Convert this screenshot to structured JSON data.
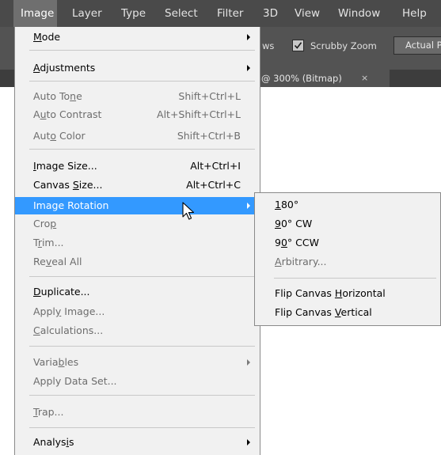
{
  "menubar": {
    "items": [
      "Image",
      "Layer",
      "Type",
      "Select",
      "Filter",
      "3D",
      "View",
      "Window",
      "Help"
    ]
  },
  "options_bar": {
    "partial_label": "ws",
    "scrubby_zoom_label": "Scrubby Zoom",
    "scrubby_zoom_checked": true,
    "actual_button_label": "Actual P"
  },
  "document_tab": {
    "title": "@ 300% (Bitmap)",
    "close": "×"
  },
  "image_menu": {
    "items": [
      {
        "pre": "",
        "u": "M",
        "post": "ode",
        "shortcut": "",
        "submenu": true,
        "enabled": true
      },
      {
        "pre": "",
        "u": "A",
        "post": "djustments",
        "shortcut": "",
        "submenu": true,
        "enabled": true
      },
      {
        "pre": "Auto To",
        "u": "n",
        "post": "e",
        "shortcut": "Shift+Ctrl+L",
        "submenu": false,
        "enabled": false
      },
      {
        "pre": "A",
        "u": "u",
        "post": "to Contrast",
        "shortcut": "Alt+Shift+Ctrl+L",
        "submenu": false,
        "enabled": false
      },
      {
        "pre": "Aut",
        "u": "o",
        "post": " Color",
        "shortcut": "Shift+Ctrl+B",
        "submenu": false,
        "enabled": false
      },
      {
        "pre": "",
        "u": "I",
        "post": "mage Size...",
        "shortcut": "Alt+Ctrl+I",
        "submenu": false,
        "enabled": true
      },
      {
        "pre": "Canvas ",
        "u": "S",
        "post": "ize...",
        "shortcut": "Alt+Ctrl+C",
        "submenu": false,
        "enabled": true
      },
      {
        "pre": "Image Rotation",
        "u": "",
        "post": "",
        "shortcut": "",
        "submenu": true,
        "enabled": true,
        "highlighted": true
      },
      {
        "pre": "Cro",
        "u": "p",
        "post": "",
        "shortcut": "",
        "submenu": false,
        "enabled": false
      },
      {
        "pre": "T",
        "u": "r",
        "post": "im...",
        "shortcut": "",
        "submenu": false,
        "enabled": false
      },
      {
        "pre": "Re",
        "u": "v",
        "post": "eal All",
        "shortcut": "",
        "submenu": false,
        "enabled": false
      },
      {
        "pre": "",
        "u": "D",
        "post": "uplicate...",
        "shortcut": "",
        "submenu": false,
        "enabled": true
      },
      {
        "pre": "Appl",
        "u": "y",
        "post": " Image...",
        "shortcut": "",
        "submenu": false,
        "enabled": false
      },
      {
        "pre": "",
        "u": "C",
        "post": "alculations...",
        "shortcut": "",
        "submenu": false,
        "enabled": false
      },
      {
        "pre": "Varia",
        "u": "b",
        "post": "les",
        "shortcut": "",
        "submenu": true,
        "enabled": false
      },
      {
        "pre": "Apply Data Set...",
        "u": "",
        "post": "",
        "shortcut": "",
        "submenu": false,
        "enabled": false
      },
      {
        "pre": "",
        "u": "T",
        "post": "rap...",
        "shortcut": "",
        "submenu": false,
        "enabled": false
      },
      {
        "pre": "Analys",
        "u": "i",
        "post": "s",
        "shortcut": "",
        "submenu": true,
        "enabled": true
      }
    ]
  },
  "rotation_submenu": {
    "items": [
      {
        "pre": "",
        "u": "1",
        "post": "80°",
        "enabled": true
      },
      {
        "pre": "",
        "u": "9",
        "post": "0° CW",
        "enabled": true
      },
      {
        "pre": "9",
        "u": "0",
        "post": "° CCW",
        "enabled": true
      },
      {
        "pre": "",
        "u": "A",
        "post": "rbitrary...",
        "enabled": false
      },
      {
        "pre": "Flip Canvas ",
        "u": "H",
        "post": "orizontal",
        "enabled": true
      },
      {
        "pre": "Flip Canvas ",
        "u": "V",
        "post": "ertical",
        "enabled": true
      }
    ]
  },
  "colors": {
    "menubar_bg": "#4a4a4a",
    "highlight": "#3399ff",
    "menu_bg": "#f1f1f1",
    "disabled_text": "#6d6d6d"
  }
}
